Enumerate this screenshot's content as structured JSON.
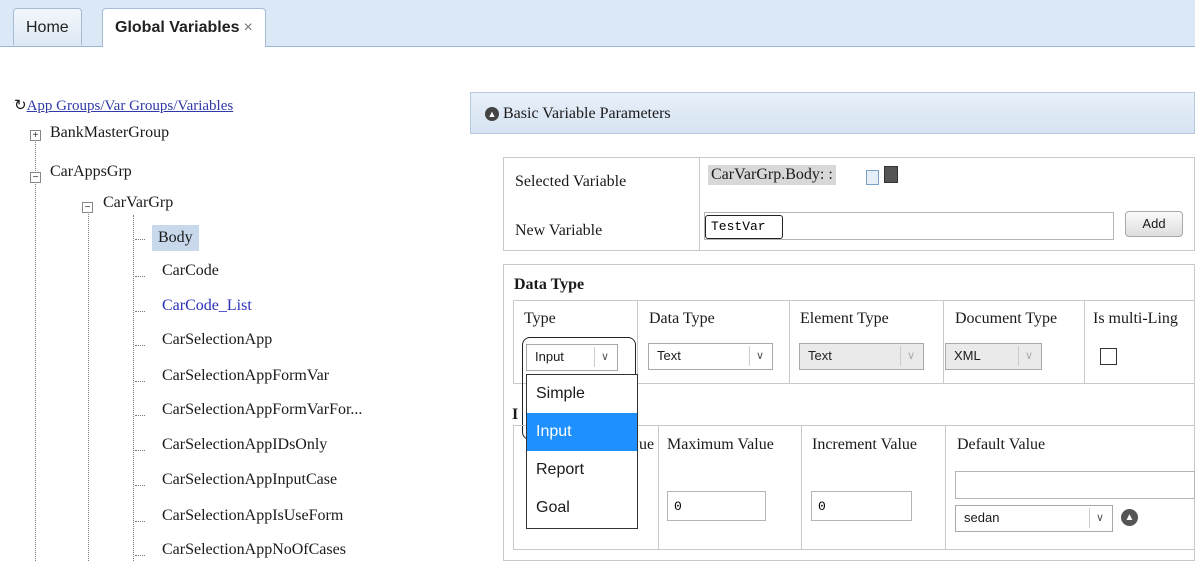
{
  "tabs": [
    {
      "label": "Home"
    },
    {
      "label": "Global Variables",
      "close": "×"
    }
  ],
  "tree": {
    "root_label": "App Groups/Var Groups/Variables",
    "groups": [
      {
        "label": "BankMasterGroup",
        "toggle": "+"
      },
      {
        "label": "CarAppsGrp",
        "toggle": "−"
      },
      {
        "label": "CarVarGrp",
        "toggle": "−"
      }
    ],
    "variables": [
      "Body",
      "CarCode",
      "CarCode_List",
      "CarSelectionApp",
      "CarSelectionAppFormVar",
      "CarSelectionAppFormVarFor...",
      "CarSelectionAppIDsOnly",
      "CarSelectionAppInputCase",
      "CarSelectionAppIsUseForm",
      "CarSelectionAppNoOfCases"
    ]
  },
  "panel": {
    "title": "Basic Variable Parameters",
    "selected_variable_label": "Selected Variable",
    "selected_variable_value": "CarVarGrp.Body: :",
    "new_variable_label": "New Variable",
    "new_variable_value": "TestVar",
    "add_button": "Add"
  },
  "data_type": {
    "section_title": "Data Type",
    "columns": [
      "Type",
      "Data Type",
      "Element Type",
      "Document Type",
      "Is multi-Ling"
    ],
    "type_value": "Input",
    "data_type_value": "Text",
    "element_type_value": "Text",
    "document_type_value": "XML",
    "dropdown_options": [
      "Simple",
      "Input",
      "Report",
      "Goal"
    ],
    "highlighted_option": "Input"
  },
  "input_section": {
    "title_partial": "I",
    "min_label_partial": "ue",
    "max_label": "Maximum Value",
    "increment_label": "Increment Value",
    "default_label": "Default Value",
    "max_value": "0",
    "increment_value": "0",
    "default_select_value": "sedan"
  }
}
